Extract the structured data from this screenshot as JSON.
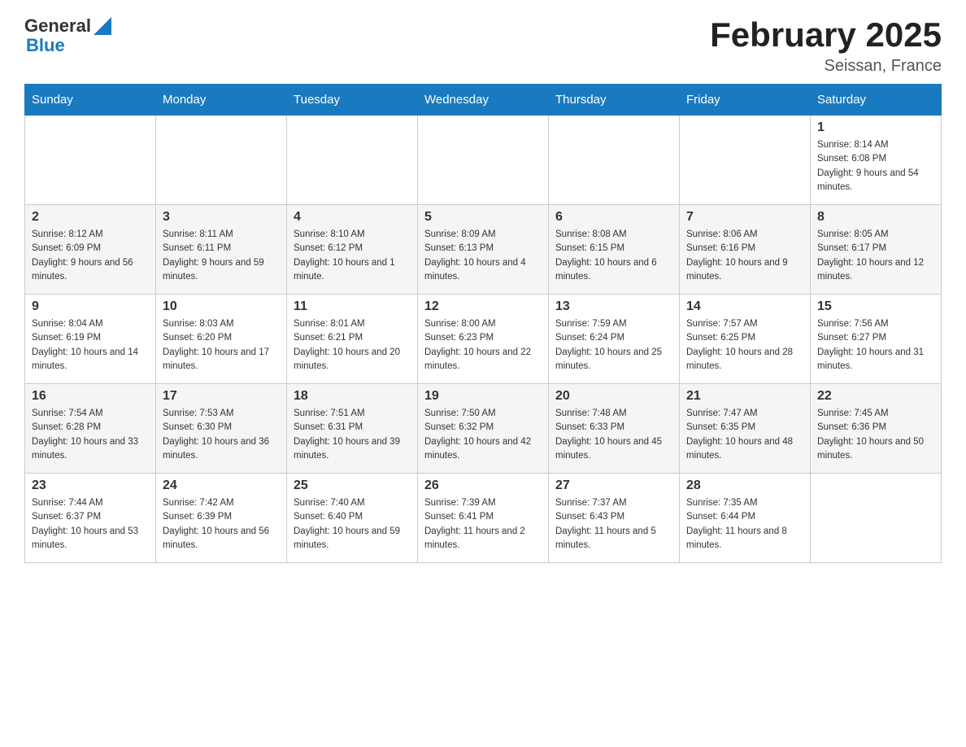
{
  "header": {
    "logo_general": "General",
    "logo_blue": "Blue",
    "title": "February 2025",
    "location": "Seissan, France"
  },
  "days_of_week": [
    "Sunday",
    "Monday",
    "Tuesday",
    "Wednesday",
    "Thursday",
    "Friday",
    "Saturday"
  ],
  "weeks": [
    [
      {
        "day": "",
        "info": ""
      },
      {
        "day": "",
        "info": ""
      },
      {
        "day": "",
        "info": ""
      },
      {
        "day": "",
        "info": ""
      },
      {
        "day": "",
        "info": ""
      },
      {
        "day": "",
        "info": ""
      },
      {
        "day": "1",
        "info": "Sunrise: 8:14 AM\nSunset: 6:08 PM\nDaylight: 9 hours and 54 minutes."
      }
    ],
    [
      {
        "day": "2",
        "info": "Sunrise: 8:12 AM\nSunset: 6:09 PM\nDaylight: 9 hours and 56 minutes."
      },
      {
        "day": "3",
        "info": "Sunrise: 8:11 AM\nSunset: 6:11 PM\nDaylight: 9 hours and 59 minutes."
      },
      {
        "day": "4",
        "info": "Sunrise: 8:10 AM\nSunset: 6:12 PM\nDaylight: 10 hours and 1 minute."
      },
      {
        "day": "5",
        "info": "Sunrise: 8:09 AM\nSunset: 6:13 PM\nDaylight: 10 hours and 4 minutes."
      },
      {
        "day": "6",
        "info": "Sunrise: 8:08 AM\nSunset: 6:15 PM\nDaylight: 10 hours and 6 minutes."
      },
      {
        "day": "7",
        "info": "Sunrise: 8:06 AM\nSunset: 6:16 PM\nDaylight: 10 hours and 9 minutes."
      },
      {
        "day": "8",
        "info": "Sunrise: 8:05 AM\nSunset: 6:17 PM\nDaylight: 10 hours and 12 minutes."
      }
    ],
    [
      {
        "day": "9",
        "info": "Sunrise: 8:04 AM\nSunset: 6:19 PM\nDaylight: 10 hours and 14 minutes."
      },
      {
        "day": "10",
        "info": "Sunrise: 8:03 AM\nSunset: 6:20 PM\nDaylight: 10 hours and 17 minutes."
      },
      {
        "day": "11",
        "info": "Sunrise: 8:01 AM\nSunset: 6:21 PM\nDaylight: 10 hours and 20 minutes."
      },
      {
        "day": "12",
        "info": "Sunrise: 8:00 AM\nSunset: 6:23 PM\nDaylight: 10 hours and 22 minutes."
      },
      {
        "day": "13",
        "info": "Sunrise: 7:59 AM\nSunset: 6:24 PM\nDaylight: 10 hours and 25 minutes."
      },
      {
        "day": "14",
        "info": "Sunrise: 7:57 AM\nSunset: 6:25 PM\nDaylight: 10 hours and 28 minutes."
      },
      {
        "day": "15",
        "info": "Sunrise: 7:56 AM\nSunset: 6:27 PM\nDaylight: 10 hours and 31 minutes."
      }
    ],
    [
      {
        "day": "16",
        "info": "Sunrise: 7:54 AM\nSunset: 6:28 PM\nDaylight: 10 hours and 33 minutes."
      },
      {
        "day": "17",
        "info": "Sunrise: 7:53 AM\nSunset: 6:30 PM\nDaylight: 10 hours and 36 minutes."
      },
      {
        "day": "18",
        "info": "Sunrise: 7:51 AM\nSunset: 6:31 PM\nDaylight: 10 hours and 39 minutes."
      },
      {
        "day": "19",
        "info": "Sunrise: 7:50 AM\nSunset: 6:32 PM\nDaylight: 10 hours and 42 minutes."
      },
      {
        "day": "20",
        "info": "Sunrise: 7:48 AM\nSunset: 6:33 PM\nDaylight: 10 hours and 45 minutes."
      },
      {
        "day": "21",
        "info": "Sunrise: 7:47 AM\nSunset: 6:35 PM\nDaylight: 10 hours and 48 minutes."
      },
      {
        "day": "22",
        "info": "Sunrise: 7:45 AM\nSunset: 6:36 PM\nDaylight: 10 hours and 50 minutes."
      }
    ],
    [
      {
        "day": "23",
        "info": "Sunrise: 7:44 AM\nSunset: 6:37 PM\nDaylight: 10 hours and 53 minutes."
      },
      {
        "day": "24",
        "info": "Sunrise: 7:42 AM\nSunset: 6:39 PM\nDaylight: 10 hours and 56 minutes."
      },
      {
        "day": "25",
        "info": "Sunrise: 7:40 AM\nSunset: 6:40 PM\nDaylight: 10 hours and 59 minutes."
      },
      {
        "day": "26",
        "info": "Sunrise: 7:39 AM\nSunset: 6:41 PM\nDaylight: 11 hours and 2 minutes."
      },
      {
        "day": "27",
        "info": "Sunrise: 7:37 AM\nSunset: 6:43 PM\nDaylight: 11 hours and 5 minutes."
      },
      {
        "day": "28",
        "info": "Sunrise: 7:35 AM\nSunset: 6:44 PM\nDaylight: 11 hours and 8 minutes."
      },
      {
        "day": "",
        "info": ""
      }
    ]
  ]
}
